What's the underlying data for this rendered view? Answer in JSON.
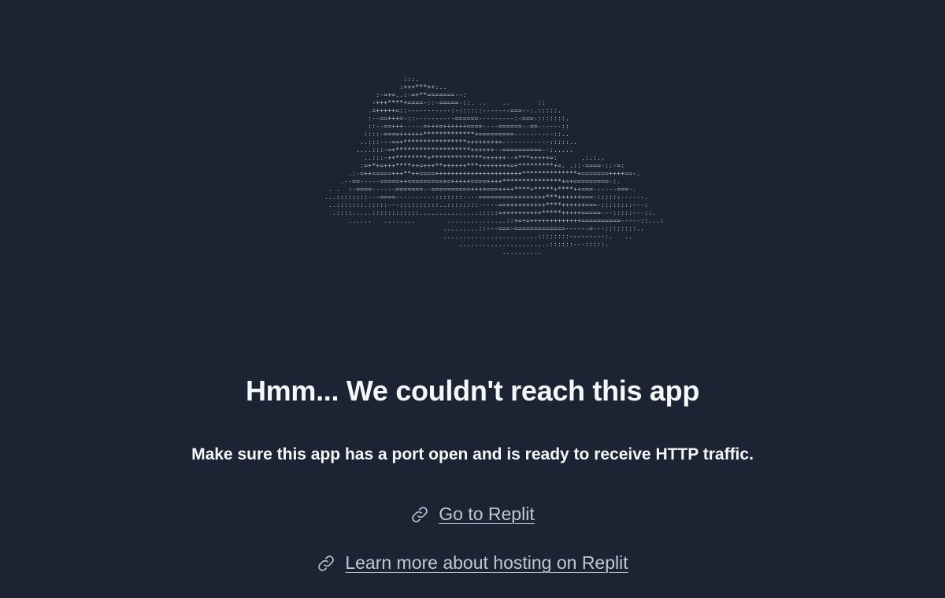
{
  "ascii_art": "                    :::.\n                   :+++***++:..\n             :-=+=..:-=+**=======--:\n            -+++****+====-::-=====-::. ..    ..       ::\n           .=+++++=::-----------:-::::::-------===--:.:::::.\n           :--==+++=-::----------======---------:-===-:::::::.\n           ::--==+++-----=+++=++++++====----======--==------::\n          ::::-====++++++*************+=========----------::..\n         ..:::---==+****************++++++++=------------:::::..\n        ....:::-=+*******************++++++--==========--:.....\n          ..:::-++********+*************++++++--+***+++++=:      .:.:..\n         :=+*+=+++****++=+++**++++++***++++++++=+*********+=. .::-====-::-=:\n      .:-=++=====+++**++====++++++++++++++++++++++**************+=======++++==-.\n    .--==-----=====++=========+=+++++====++++***************+=+=========-:.\n . .  :-====------=======--==========+++====++++****+*****+****++===------===-.\n...::::::::---====----------:::::::----=========++++++++***++++++===-::::::------.\n ..:::::::.:::::---::::::::::..::::::::-----==++++++++++****++++++===-::::::::---:\n  .::::.....::::::::::::...............:::::=++++++++++*****+++++=====---:::::---::.\n      ......   ........        ...............::+=+=+++++++++++++==========-----::...:\n                              .........::---===-=============------=---::::::::..\n                              ........................::::::::---------:.   ..\n                                  .......................::::::---:::::.\n                                             ..........",
  "error": {
    "title": "Hmm... We couldn't reach this app",
    "message": "Make sure this app has a port open and is ready to receive HTTP traffic."
  },
  "links": [
    {
      "label": "Go to Replit",
      "icon": "link-icon"
    },
    {
      "label": "Learn more about hosting on Replit",
      "icon": "link-icon"
    }
  ],
  "colors": {
    "background": "#1c2333",
    "text": "#f5f9fc",
    "link": "#c2c8d0",
    "ascii": "#b8c2cf"
  }
}
